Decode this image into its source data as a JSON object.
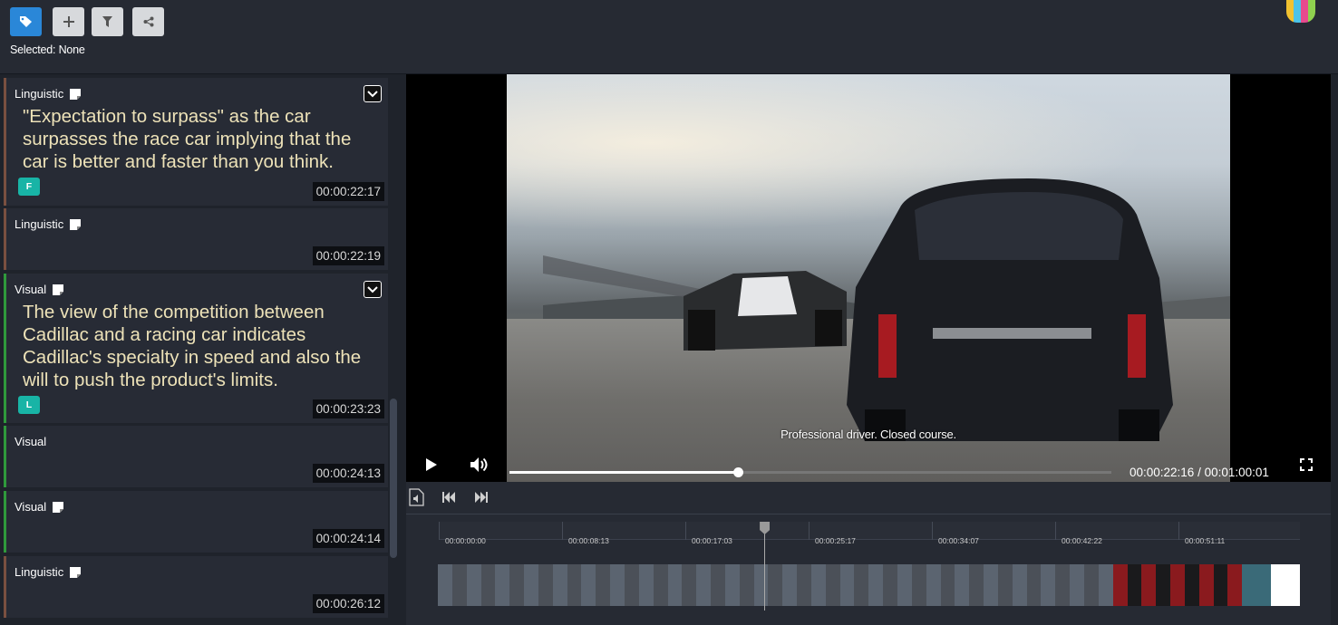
{
  "toolbar": {
    "buttons": [
      {
        "name": "tag-button",
        "icon": "tag-icon",
        "active": true
      },
      {
        "name": "add-button",
        "icon": "plus-icon",
        "active": false
      },
      {
        "name": "filter-button",
        "icon": "filter-icon",
        "active": false
      },
      {
        "name": "share-button",
        "icon": "share-icon",
        "active": false
      }
    ],
    "selected_label": "Selected: None",
    "logo_colors": [
      "#f2c230",
      "#4cc3e8",
      "#e84a8e",
      "#8fd14f"
    ]
  },
  "annotations": [
    {
      "type": "Linguistic",
      "has_note": true,
      "expandable": true,
      "text": "\"Expectation to surpass\" as the car surpasses the race car implying that the car is better and faster than you think.",
      "tag": "F",
      "time": "00:00:22:17"
    },
    {
      "type": "Linguistic",
      "has_note": true,
      "expandable": false,
      "text": "",
      "tag": "",
      "time": "00:00:22:19"
    },
    {
      "type": "Visual",
      "has_note": true,
      "expandable": true,
      "text": "The view of the competition between Cadillac and a racing car indicates Cadillac's specialty in speed and also the will to push the product's limits.",
      "tag": "L",
      "time": "00:00:23:23"
    },
    {
      "type": "Visual",
      "has_note": false,
      "expandable": false,
      "text": "",
      "tag": "",
      "time": "00:00:24:13"
    },
    {
      "type": "Visual",
      "has_note": true,
      "expandable": false,
      "text": "",
      "tag": "",
      "time": "00:00:24:14"
    },
    {
      "type": "Linguistic",
      "has_note": true,
      "expandable": false,
      "text": "",
      "tag": "",
      "time": "00:00:26:12"
    }
  ],
  "colors": {
    "linguistic_border": "#7a5040",
    "visual_border": "#2f9a3c",
    "tag_teal": "#18b4a6",
    "accent_blue": "#2a87d8",
    "annotation_text": "#ede2b8"
  },
  "player": {
    "subtitle": "Professional driver. Closed course.",
    "time_readout": "00:00:22:16 / 00:01:00:01",
    "progress_fraction": 0.38,
    "play_icon": "play-icon",
    "volume_icon": "volume-icon",
    "fullscreen_icon": "fullscreen-icon"
  },
  "subtools": [
    {
      "name": "audio-track-button",
      "icon": "audio-file-icon"
    },
    {
      "name": "skip-back-button",
      "icon": "skip-back-icon"
    },
    {
      "name": "skip-forward-button",
      "icon": "skip-forward-icon"
    }
  ],
  "timeline": {
    "ticks": [
      "00:00:00:00",
      "00:00:08:13",
      "00:00:17:03",
      "00:00:25:17",
      "00:00:34:07",
      "00:00:42:22",
      "00:00:51:11"
    ],
    "playhead_fraction": 0.378
  }
}
